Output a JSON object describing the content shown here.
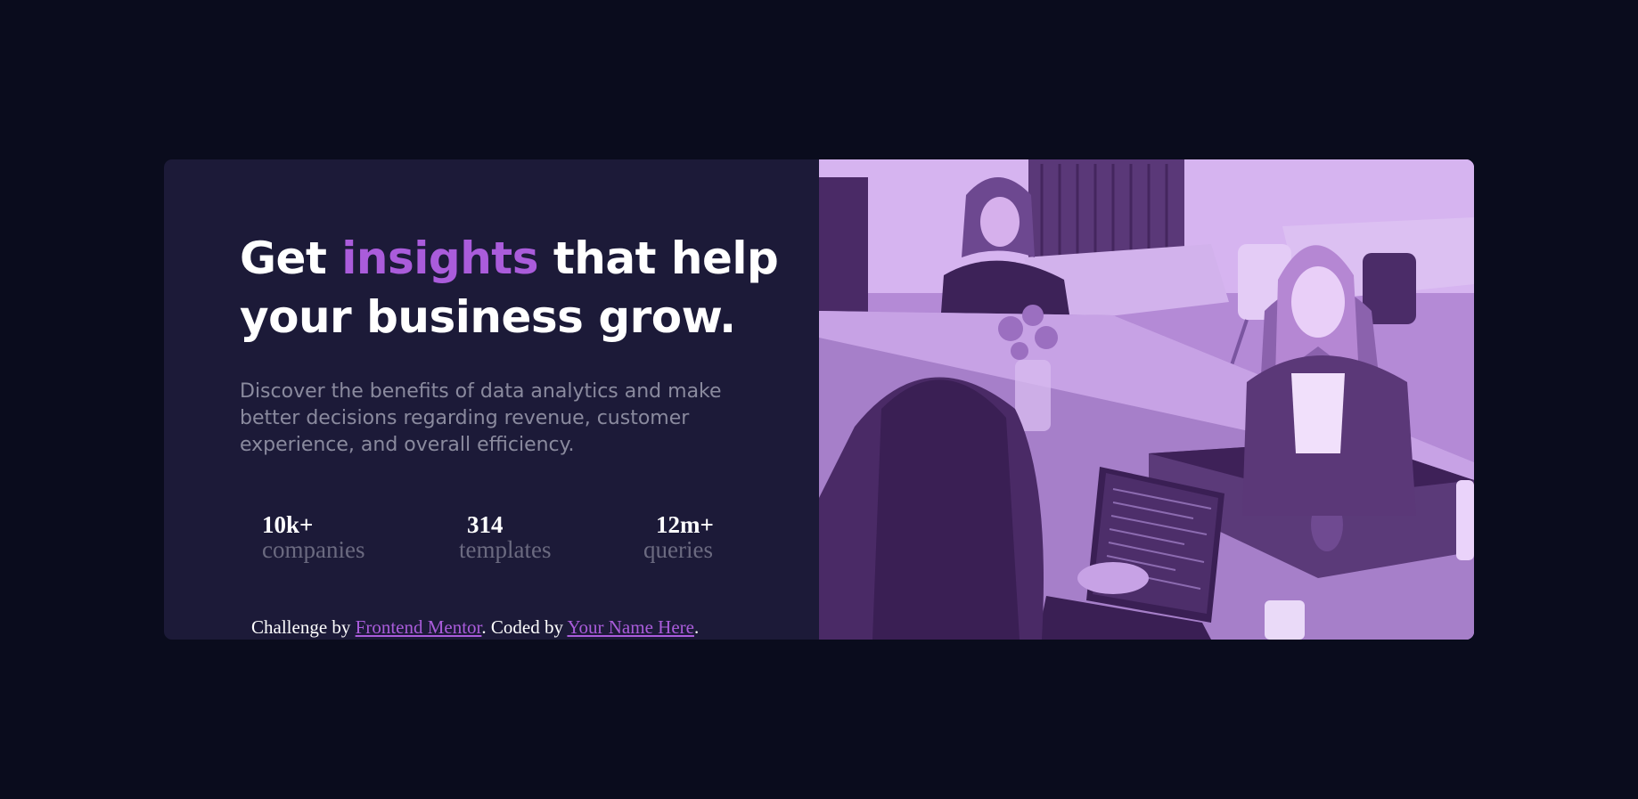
{
  "hero": {
    "headline_part1": "Get ",
    "headline_accent": "insights",
    "headline_part2": " that help your business grow.",
    "description": "Discover the benefits of data analytics and make better decisions regarding revenue, customer experience, and overall efficiency."
  },
  "stats": [
    {
      "value": "10k+",
      "label": "companies"
    },
    {
      "value": "314",
      "label": "templates"
    },
    {
      "value": "12m+",
      "label": "queries"
    }
  ],
  "attribution": {
    "prefix": "Challenge by ",
    "link1": "Frontend Mentor",
    "middle": ". Coded by ",
    "link2": "Your Name Here",
    "suffix": "."
  },
  "colors": {
    "background": "#0a0c1d",
    "card": "#1c1a38",
    "accent": "#aa5cdb",
    "photo_tint": "#c39ce6"
  }
}
